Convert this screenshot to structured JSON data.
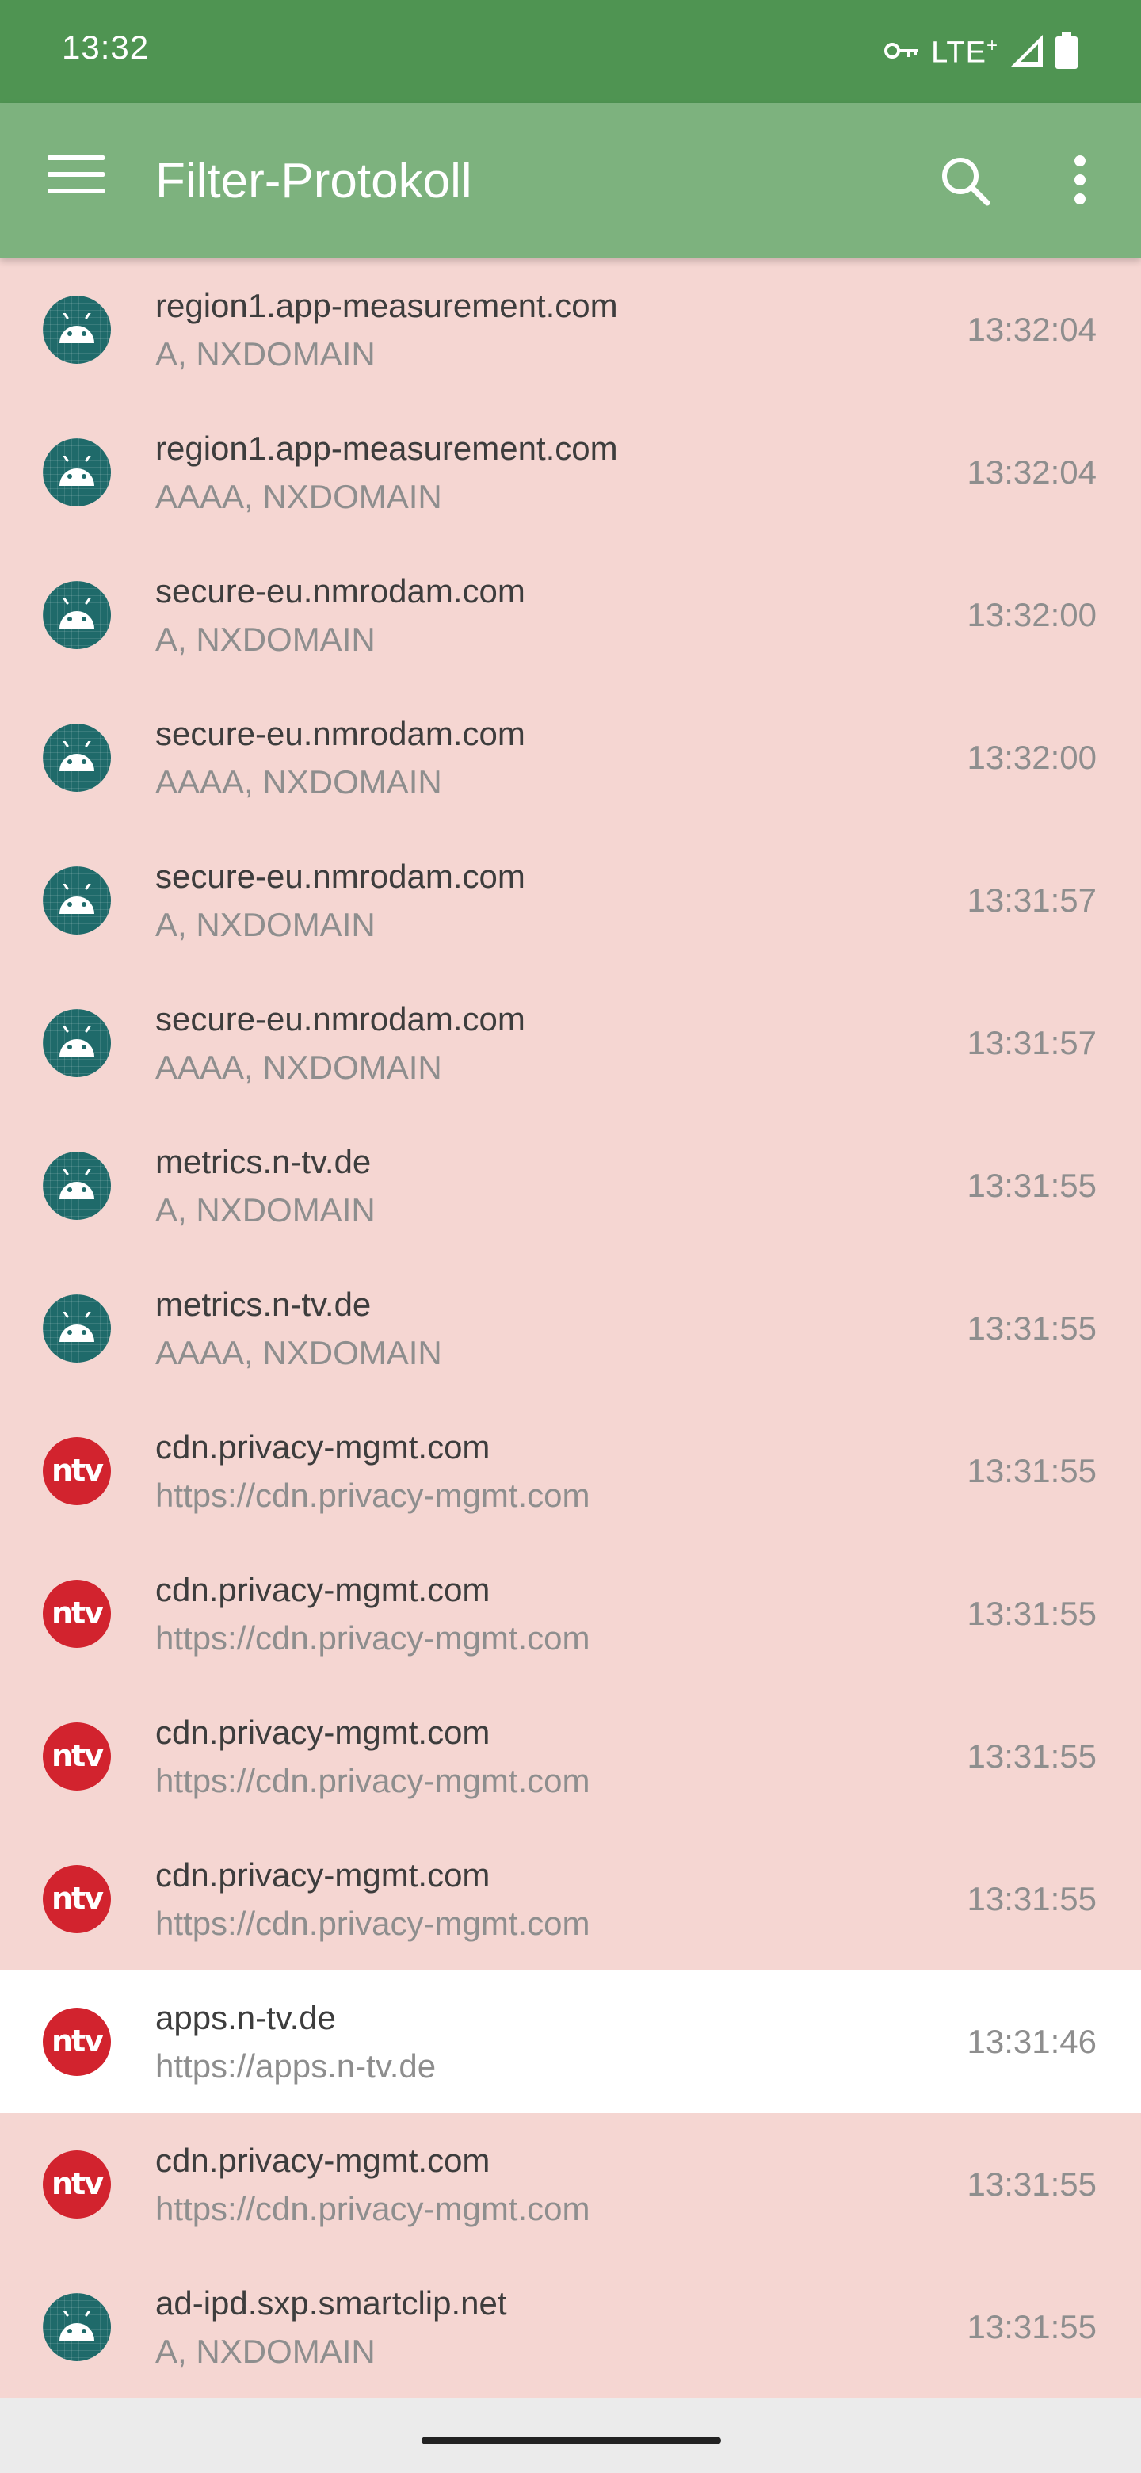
{
  "status_bar": {
    "time": "13:32",
    "network": "LTE",
    "network_sup": "+",
    "icons": [
      "vpn-key-icon",
      "signal-icon",
      "battery-icon"
    ]
  },
  "app_bar": {
    "title": "Filter-Protokoll",
    "icons": [
      "menu-icon",
      "search-icon",
      "more-vert-icon"
    ]
  },
  "colors": {
    "status_bar": "#4f9452",
    "app_bar": "#7db27e",
    "blocked_row": "#f5d6d2",
    "allowed_row": "#ffffff",
    "android_icon": "#1f6a6a",
    "ntv_icon": "#d2232e"
  },
  "log": [
    {
      "icon": "android-icon",
      "host": "region1.app-measurement.com",
      "detail": "A, NXDOMAIN",
      "time": "13:32:04",
      "status": "blocked"
    },
    {
      "icon": "android-icon",
      "host": "region1.app-measurement.com",
      "detail": "AAAA, NXDOMAIN",
      "time": "13:32:04",
      "status": "blocked"
    },
    {
      "icon": "android-icon",
      "host": "secure-eu.nmrodam.com",
      "detail": "A, NXDOMAIN",
      "time": "13:32:00",
      "status": "blocked"
    },
    {
      "icon": "android-icon",
      "host": "secure-eu.nmrodam.com",
      "detail": "AAAA, NXDOMAIN",
      "time": "13:32:00",
      "status": "blocked"
    },
    {
      "icon": "android-icon",
      "host": "secure-eu.nmrodam.com",
      "detail": "A, NXDOMAIN",
      "time": "13:31:57",
      "status": "blocked"
    },
    {
      "icon": "android-icon",
      "host": "secure-eu.nmrodam.com",
      "detail": "AAAA, NXDOMAIN",
      "time": "13:31:57",
      "status": "blocked"
    },
    {
      "icon": "android-icon",
      "host": "metrics.n-tv.de",
      "detail": "A, NXDOMAIN",
      "time": "13:31:55",
      "status": "blocked"
    },
    {
      "icon": "android-icon",
      "host": "metrics.n-tv.de",
      "detail": "AAAA, NXDOMAIN",
      "time": "13:31:55",
      "status": "blocked"
    },
    {
      "icon": "ntv-app-icon",
      "icon_text": "ntv",
      "host": "cdn.privacy-mgmt.com",
      "detail": "https://cdn.privacy-mgmt.com",
      "time": "13:31:55",
      "status": "blocked"
    },
    {
      "icon": "ntv-app-icon",
      "icon_text": "ntv",
      "host": "cdn.privacy-mgmt.com",
      "detail": "https://cdn.privacy-mgmt.com",
      "time": "13:31:55",
      "status": "blocked"
    },
    {
      "icon": "ntv-app-icon",
      "icon_text": "ntv",
      "host": "cdn.privacy-mgmt.com",
      "detail": "https://cdn.privacy-mgmt.com",
      "time": "13:31:55",
      "status": "blocked"
    },
    {
      "icon": "ntv-app-icon",
      "icon_text": "ntv",
      "host": "cdn.privacy-mgmt.com",
      "detail": "https://cdn.privacy-mgmt.com",
      "time": "13:31:55",
      "status": "blocked"
    },
    {
      "icon": "ntv-app-icon",
      "icon_text": "ntv",
      "host": "apps.n-tv.de",
      "detail": "https://apps.n-tv.de",
      "time": "13:31:46",
      "status": "allowed"
    },
    {
      "icon": "ntv-app-icon",
      "icon_text": "ntv",
      "host": "cdn.privacy-mgmt.com",
      "detail": "https://cdn.privacy-mgmt.com",
      "time": "13:31:55",
      "status": "blocked"
    },
    {
      "icon": "android-icon",
      "host": "ad-ipd.sxp.smartclip.net",
      "detail": "A, NXDOMAIN",
      "time": "13:31:55",
      "status": "blocked"
    }
  ]
}
